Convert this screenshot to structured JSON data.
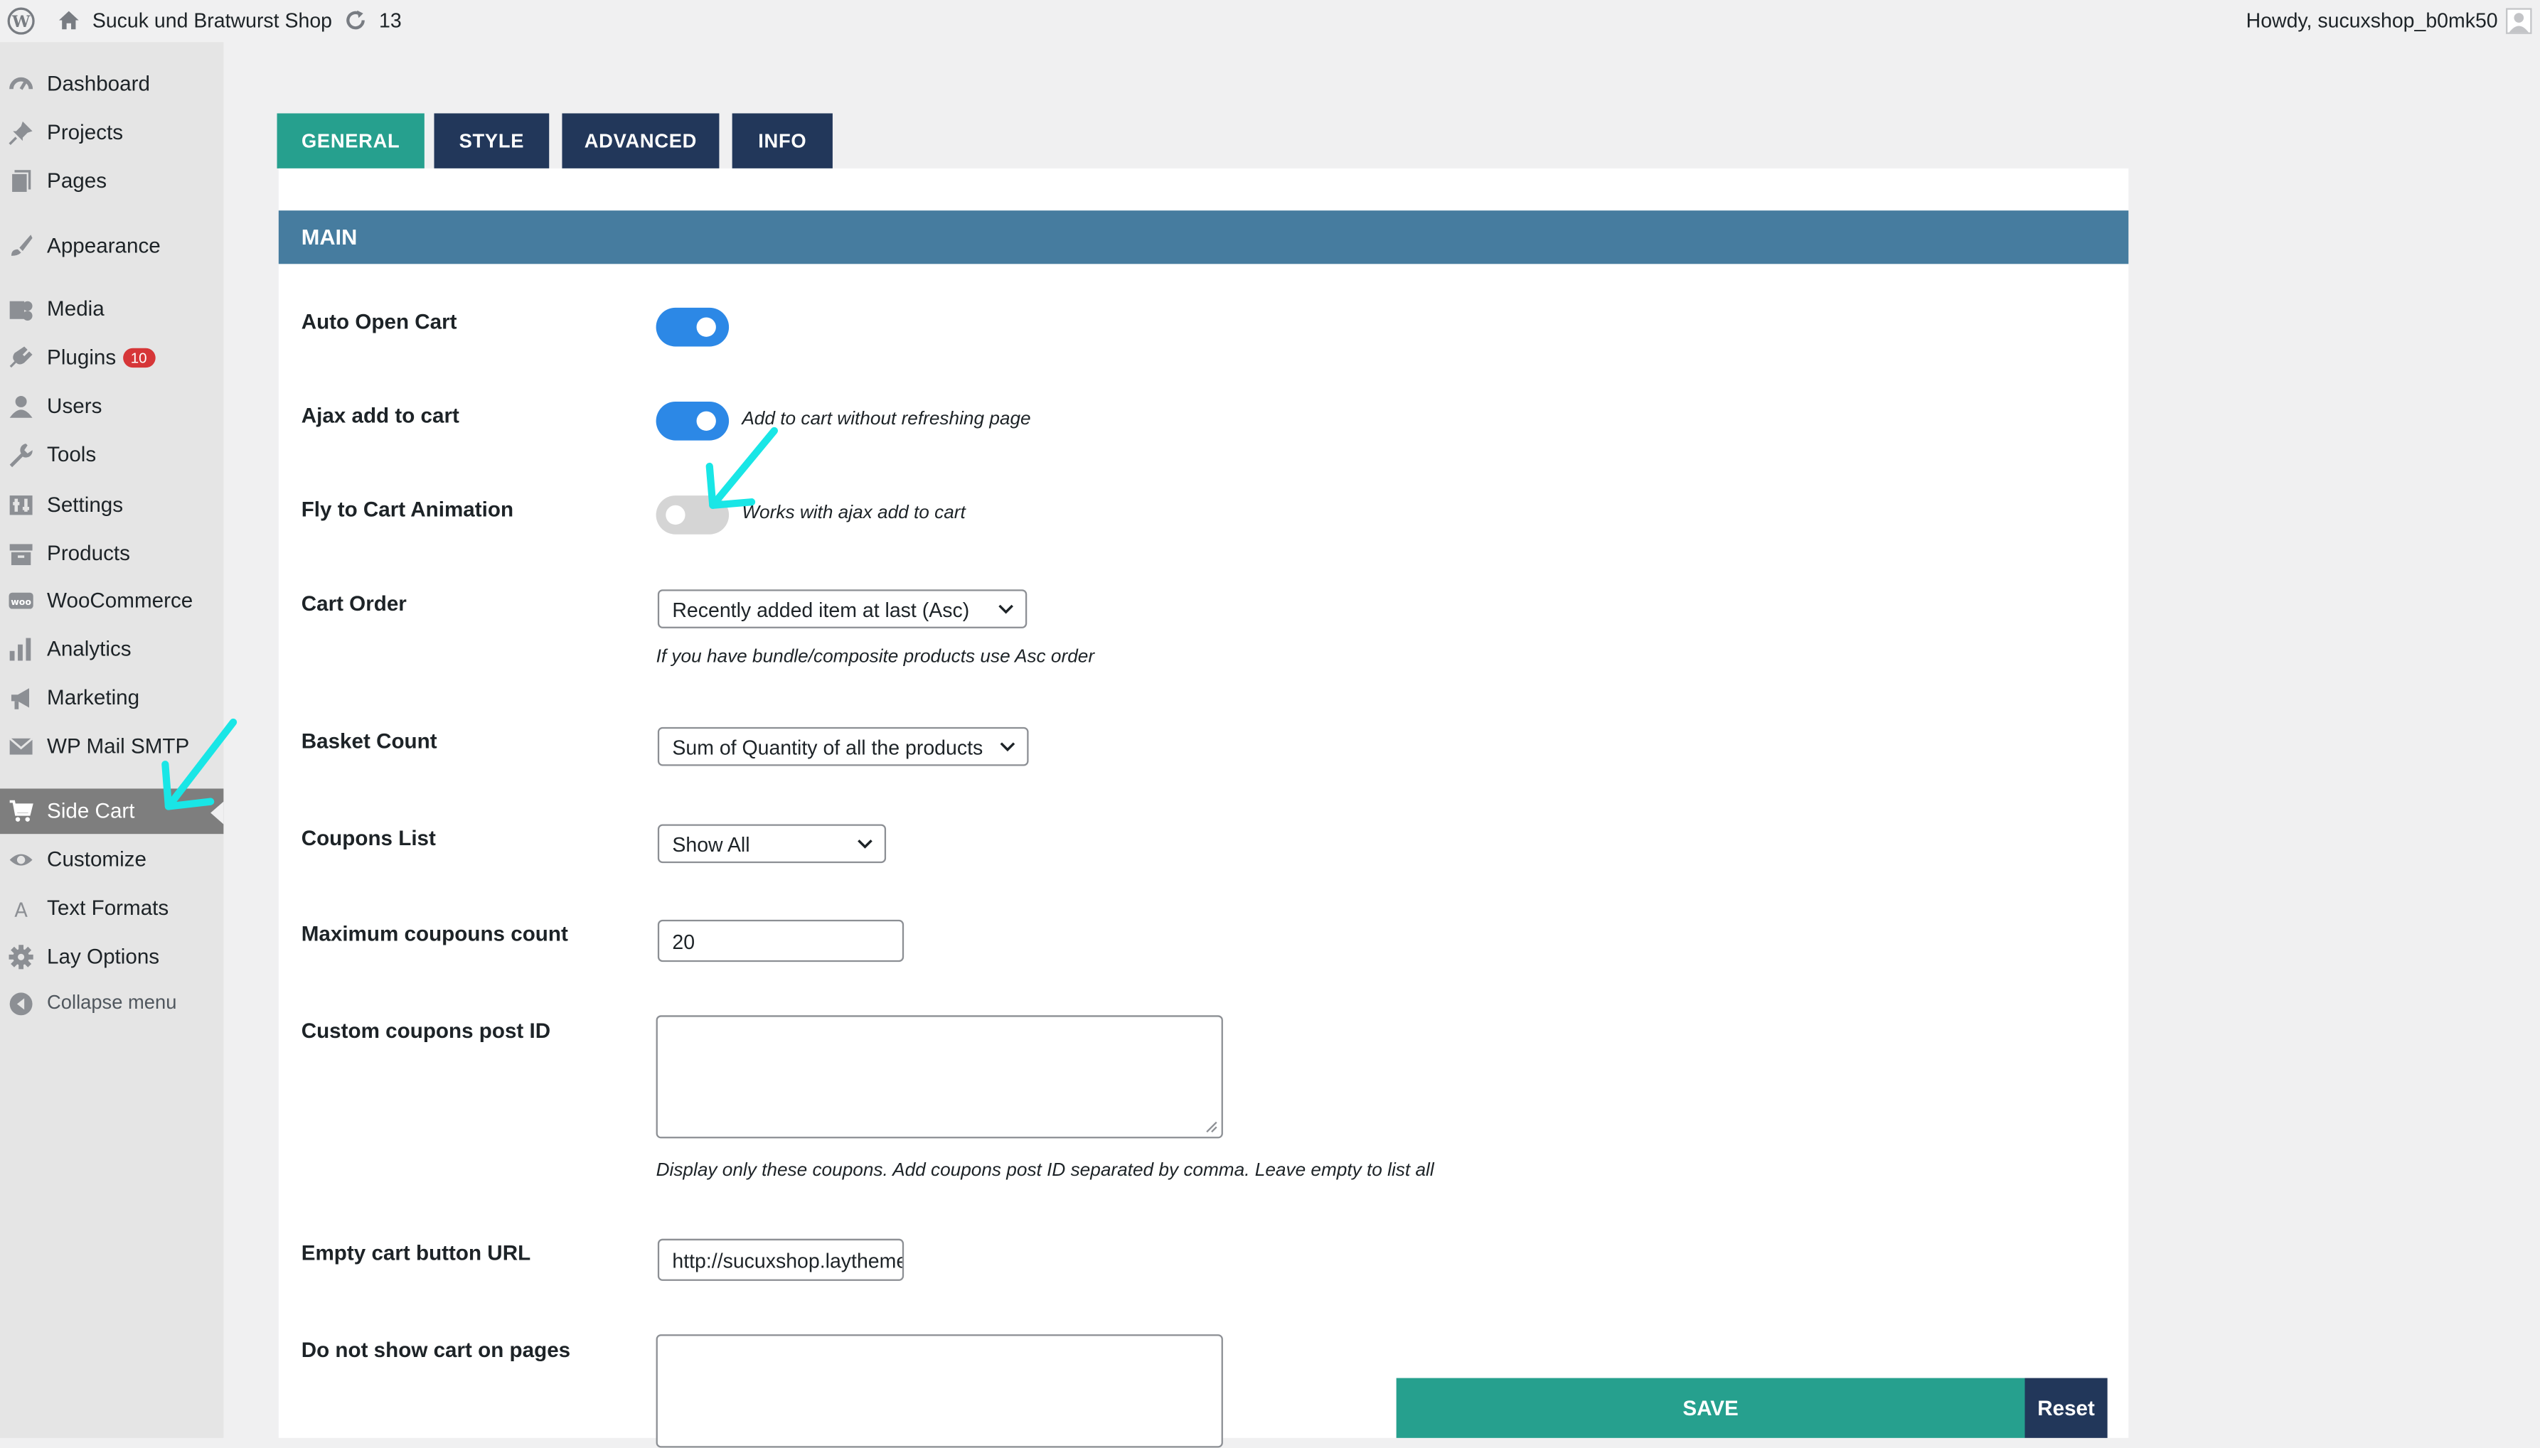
{
  "admin_bar": {
    "site_name": "Sucuk und Bratwurst Shop",
    "updates_count": "13",
    "greeting": "Howdy, sucuxshop_b0mk50"
  },
  "sidebar": {
    "items": [
      {
        "label": "Dashboard",
        "icon": "dashboard-icon"
      },
      {
        "label": "Projects",
        "icon": "pin-icon"
      },
      {
        "label": "Pages",
        "icon": "pages-icon"
      },
      {
        "label": "Appearance",
        "icon": "brush-icon"
      },
      {
        "label": "Media",
        "icon": "media-icon"
      },
      {
        "label": "Plugins",
        "icon": "plugin-icon",
        "badge": "10"
      },
      {
        "label": "Users",
        "icon": "users-icon"
      },
      {
        "label": "Tools",
        "icon": "wrench-icon"
      },
      {
        "label": "Settings",
        "icon": "settings-icon"
      },
      {
        "label": "Products",
        "icon": "archive-icon"
      },
      {
        "label": "WooCommerce",
        "icon": "woo-icon"
      },
      {
        "label": "Analytics",
        "icon": "bar-chart-icon"
      },
      {
        "label": "Marketing",
        "icon": "megaphone-icon"
      },
      {
        "label": "WP Mail SMTP",
        "icon": "mail-icon"
      },
      {
        "label": "Side Cart",
        "icon": "cart-icon",
        "active": true
      },
      {
        "label": "Customize",
        "icon": "eye-icon"
      },
      {
        "label": "Text Formats",
        "icon": "letter-a-icon"
      },
      {
        "label": "Lay Options",
        "icon": "gear-icon"
      },
      {
        "label": "Collapse menu",
        "icon": "collapse-icon"
      }
    ]
  },
  "tabs": [
    {
      "label": "GENERAL",
      "active": true
    },
    {
      "label": "STYLE"
    },
    {
      "label": "ADVANCED"
    },
    {
      "label": "INFO"
    }
  ],
  "section": {
    "title": "MAIN"
  },
  "fields": {
    "auto_open_cart": {
      "label": "Auto Open Cart",
      "enabled": true
    },
    "ajax_add_to_cart": {
      "label": "Ajax add to cart",
      "enabled": true,
      "description": "Add to cart without refreshing page"
    },
    "fly_to_cart": {
      "label": "Fly to Cart Animation",
      "enabled": false,
      "description": "Works with ajax add to cart"
    },
    "cart_order": {
      "label": "Cart Order",
      "value": "Recently added item at last (Asc)",
      "description": "If you have bundle/composite products use Asc order"
    },
    "basket_count": {
      "label": "Basket Count",
      "value": "Sum of Quantity of all the products"
    },
    "coupons_list": {
      "label": "Coupons List",
      "value": "Show All"
    },
    "max_coupons": {
      "label": "Maximum coupouns count",
      "value": "20"
    },
    "custom_coupons": {
      "label": "Custom coupons post ID",
      "value": "",
      "description": "Display only these coupons. Add coupons post ID separated by comma. Leave empty to list all"
    },
    "empty_cart_url": {
      "label": "Empty cart button URL",
      "value": "http://sucuxshop.laythemes.com"
    },
    "hide_on_pages": {
      "label": "Do not show cart on pages",
      "value": ""
    }
  },
  "buttons": {
    "save": "SAVE",
    "reset": "Reset"
  },
  "colors": {
    "accent_teal": "#26a08e",
    "navy": "#22375a",
    "section_blue": "#467c9f",
    "toggle_on": "#2c88e6",
    "annotation_arrow": "#19e6e6"
  }
}
